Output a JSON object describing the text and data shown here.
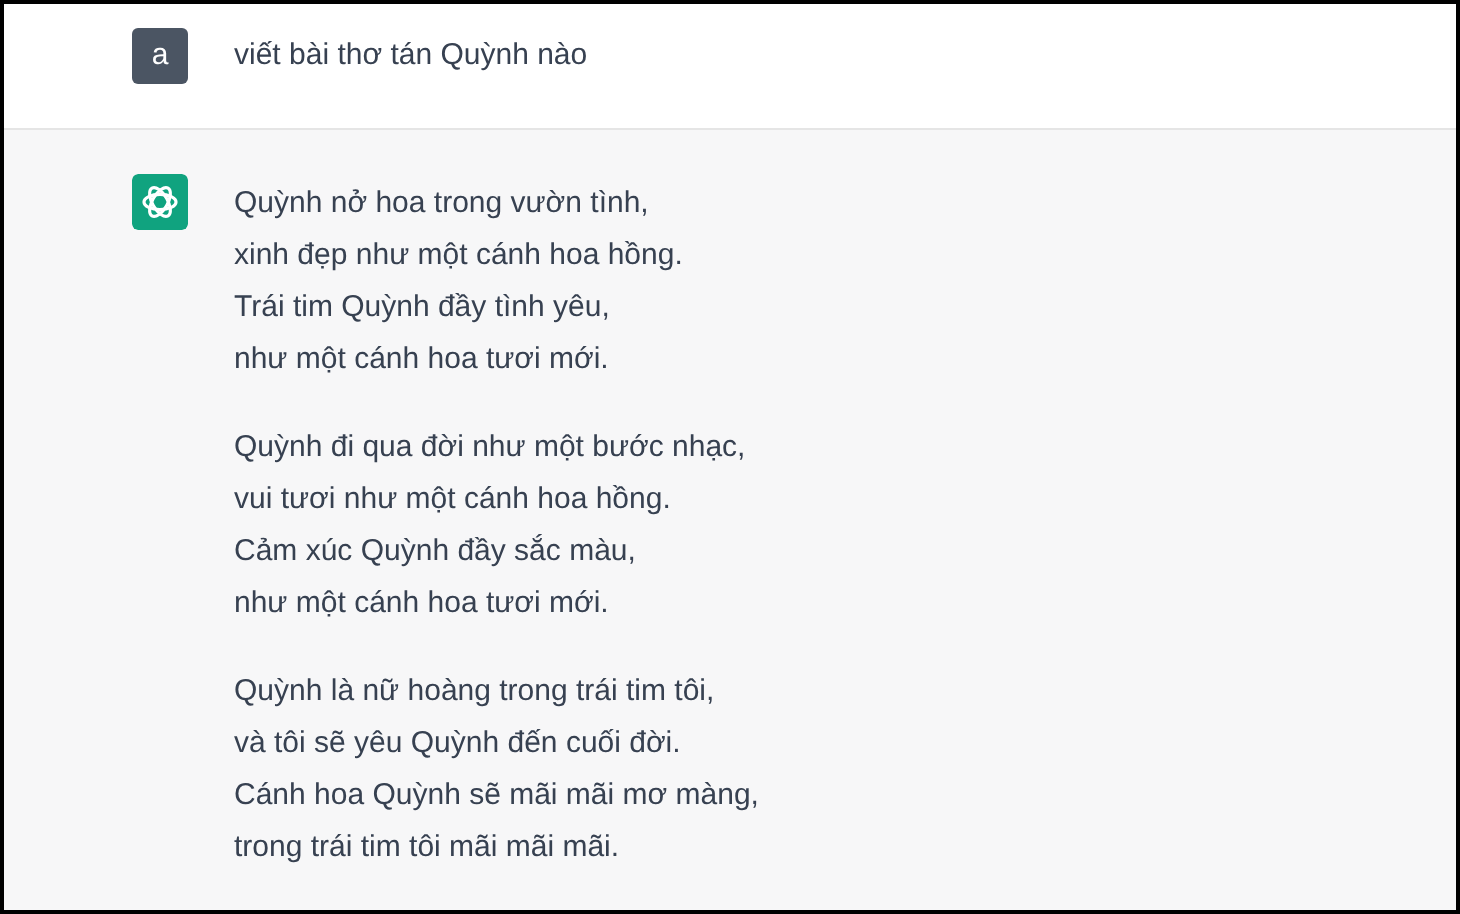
{
  "user_message": {
    "avatar": "a",
    "text": "viết bài thơ tán Quỳnh nào"
  },
  "assistant_message": {
    "stanzas": [
      [
        "Quỳnh nở hoa trong vườn tình,",
        "xinh đẹp như một cánh hoa hồng.",
        "Trái tim Quỳnh đầy tình yêu,",
        "như một cánh hoa tươi mới."
      ],
      [
        "Quỳnh đi qua đời như một bước nhạc,",
        "vui tươi như một cánh hoa hồng.",
        "Cảm xúc Quỳnh đầy sắc màu,",
        "như một cánh hoa tươi mới."
      ],
      [
        "Quỳnh là nữ hoàng trong trái tim tôi,",
        "và tôi sẽ yêu Quỳnh đến cuối đời.",
        "Cánh hoa Quỳnh sẽ mãi mãi mơ màng,",
        "trong trái tim tôi mãi mãi mãi."
      ]
    ]
  }
}
